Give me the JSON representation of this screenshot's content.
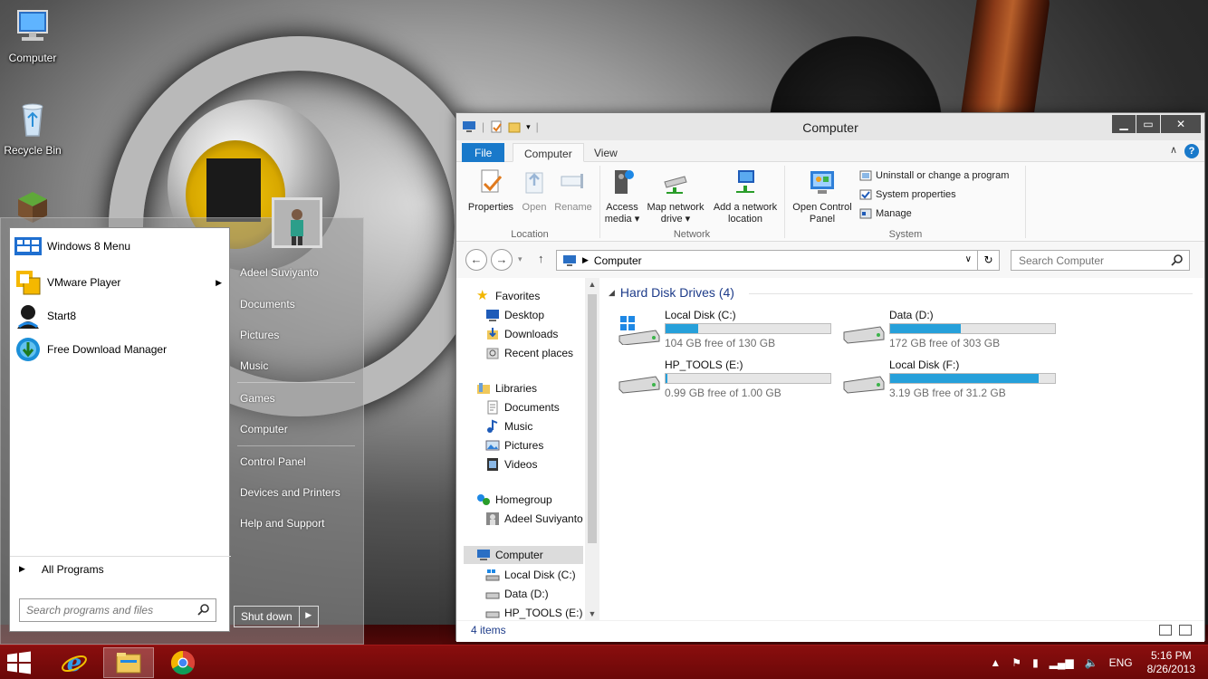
{
  "desktop": {
    "icons": [
      {
        "label": "Computer",
        "icon": "computer-icon"
      },
      {
        "label": "Recycle Bin",
        "icon": "recycle-bin-icon"
      }
    ]
  },
  "start_menu": {
    "programs": [
      {
        "label": "Windows 8 Menu",
        "icon": "windows8-menu-icon",
        "submenu": false
      },
      {
        "label": "VMware Player",
        "icon": "vmware-player-icon",
        "submenu": true
      },
      {
        "label": "Start8",
        "icon": "start8-icon",
        "submenu": false
      },
      {
        "label": "Free Download Manager",
        "icon": "free-download-manager-icon",
        "submenu": false
      }
    ],
    "all_programs": "All Programs",
    "search_placeholder": "Search programs and files",
    "right_items": [
      "Adeel Suviyanto",
      "Documents",
      "Pictures",
      "Music",
      "Games",
      "Computer",
      "Control Panel",
      "Devices and Printers",
      "Help and Support"
    ],
    "shutdown_label": "Shut down"
  },
  "explorer": {
    "title": "Computer",
    "tabs": {
      "file": "File",
      "computer": "Computer",
      "view": "View"
    },
    "ribbon": {
      "location": {
        "label": "Location",
        "buttons": [
          "Properties",
          "Open",
          "Rename"
        ]
      },
      "network": {
        "label": "Network",
        "buttons": [
          {
            "line1": "Access",
            "line2": "media ▾"
          },
          {
            "line1": "Map network",
            "line2": "drive ▾"
          },
          {
            "line1": "Add a network",
            "line2": "location"
          }
        ]
      },
      "system": {
        "label": "System",
        "open_control_panel": {
          "line1": "Open Control",
          "line2": "Panel"
        },
        "small": [
          "Uninstall or change a program",
          "System properties",
          "Manage"
        ]
      }
    },
    "address": {
      "path": "Computer"
    },
    "search_placeholder": "Search Computer",
    "nav": {
      "favorites": "Favorites",
      "favorites_items": [
        "Desktop",
        "Downloads",
        "Recent places"
      ],
      "libraries": "Libraries",
      "libraries_items": [
        "Documents",
        "Music",
        "Pictures",
        "Videos"
      ],
      "homegroup": "Homegroup",
      "homegroup_items": [
        "Adeel Suviyanto"
      ],
      "computer": "Computer",
      "computer_items": [
        "Local Disk (C:)",
        "Data (D:)",
        "HP_TOOLS (E:)"
      ]
    },
    "section_title": "Hard Disk Drives (4)",
    "drives": [
      {
        "name": "Local Disk (C:)",
        "free": "104 GB free of 130 GB",
        "used_fraction": 0.2,
        "system": true
      },
      {
        "name": "Data (D:)",
        "free": "172 GB free of 303 GB",
        "used_fraction": 0.43,
        "system": false
      },
      {
        "name": "HP_TOOLS (E:)",
        "free": "0.99 GB free of 1.00 GB",
        "used_fraction": 0.01,
        "system": false
      },
      {
        "name": "Local Disk (F:)",
        "free": "3.19 GB free of 31.2 GB",
        "used_fraction": 0.9,
        "system": false
      }
    ],
    "status": "4 items"
  },
  "taskbar": {
    "language": "ENG",
    "time": "5:16 PM",
    "date": "8/26/2013"
  },
  "colors": {
    "accent": "#1979ca",
    "drive_fill": "#26a0da",
    "taskbar": "#7a0c0c"
  }
}
